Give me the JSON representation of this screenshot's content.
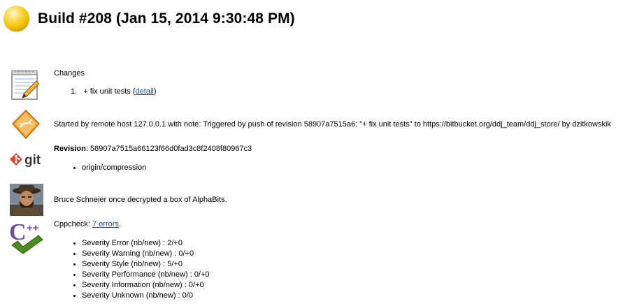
{
  "header": {
    "title": "Build #208 (Jan 15, 2014 9:30:48 PM)",
    "status_color": "#f5c400"
  },
  "changes": {
    "heading": "Changes",
    "items": [
      {
        "number": "1.",
        "text": "+ fix unit tests",
        "open_paren": "(",
        "link": "detail",
        "close_paren": ")"
      }
    ]
  },
  "cause": {
    "text": "Started by remote host 127.0.0.1 with note: Triggered by push of revision 58907a7515a6: \"+ fix unit tests\" to https://bitbucket.org/ddj_team/ddj_store/ by dzitkowskik"
  },
  "git": {
    "revision_label": "Revision",
    "revision_value": ": 58907a7515a66123f66d0fad3c8f2408f80967c3",
    "branches": [
      "origin/compression"
    ],
    "logo_text": "git"
  },
  "fact": {
    "text": "Bruce Schneier once decrypted a box of AlphaBits."
  },
  "cppcheck": {
    "label": "Cppcheck: ",
    "link": "7 errors",
    "suffix": ".",
    "severities": [
      "Severity Error (nb/new) : 2/+0",
      "Severity Warning (nb/new) : 0/+0",
      "Severity Style (nb/new) : 5/+0",
      "Severity Performance (nb/new) : 0/+0",
      "Severity Information (nb/new) : 0/+0",
      "Severity Unknown (nb/new) : 0/0"
    ]
  }
}
